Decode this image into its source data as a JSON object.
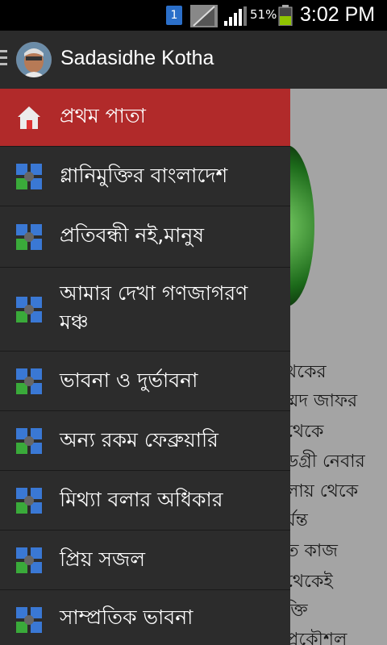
{
  "status_bar": {
    "notification_count": "1",
    "battery_percent": "51%",
    "time": "3:02 PM"
  },
  "action_bar": {
    "title": "Sadasidhe Kotha"
  },
  "drawer": {
    "items": [
      {
        "label": "প্রথম পাতা",
        "icon": "home-icon",
        "active": true
      },
      {
        "label": "গ্লানিমুক্তির বাংলাদেশ",
        "icon": "puzzle-icon"
      },
      {
        "label": "প্রতিবন্ধী নই,মানুষ",
        "icon": "puzzle-icon"
      },
      {
        "label": "আমার দেখা গণজাগরণ মঞ্চ",
        "icon": "puzzle-icon"
      },
      {
        "label": "ভাবনা ও দুর্ভাবনা",
        "icon": "puzzle-icon"
      },
      {
        "label": "অন্য রকম ফেব্রুয়ারি",
        "icon": "puzzle-icon"
      },
      {
        "label": "মিথ্যা বলার অধিকার",
        "icon": "puzzle-icon"
      },
      {
        "label": "প্রিয় সজল",
        "icon": "puzzle-icon"
      },
      {
        "label": "সাম্প্রতিক ভাবনা",
        "icon": "puzzle-icon"
      }
    ]
  },
  "background_text": [
    "থকের",
    "ম্মদ জাফর",
    "থেকে",
    "ডগ্রী নেবার",
    "লায় থেকে",
    "র্যন্ত",
    "ত কাজ",
    "থেকেই",
    "ক্তি",
    "প্রকৌশল"
  ],
  "colors": {
    "active_item": "#b12a2a",
    "drawer_bg": "#2c2c2c",
    "action_bar": "#2b2b2b"
  }
}
